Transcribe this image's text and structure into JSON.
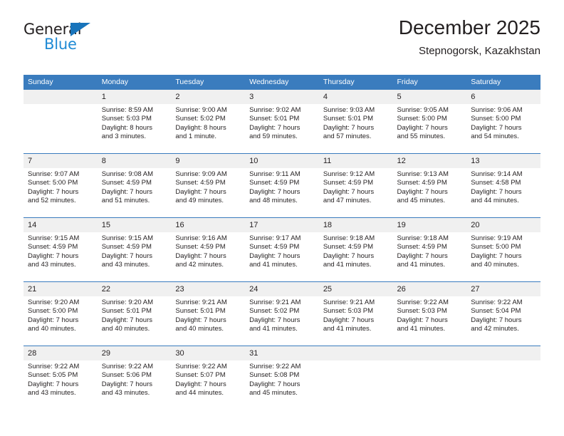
{
  "brand": {
    "name_top": "General",
    "name_bottom": "Blue",
    "accent_color": "#1f8ad4",
    "triangle_color": "#1874bb"
  },
  "header": {
    "title": "December 2025",
    "subtitle": "Stepnogorsk, Kazakhstan",
    "header_bg_color": "#3a7cbe",
    "daynum_bg_color": "#f0f0f0"
  },
  "weekday_headers": [
    "Sunday",
    "Monday",
    "Tuesday",
    "Wednesday",
    "Thursday",
    "Friday",
    "Saturday"
  ],
  "weeks": [
    [
      {
        "day": "",
        "sunrise": "",
        "sunset": "",
        "daylight1": "",
        "daylight2": "",
        "empty": true
      },
      {
        "day": "1",
        "sunrise": "Sunrise: 8:59 AM",
        "sunset": "Sunset: 5:03 PM",
        "daylight1": "Daylight: 8 hours",
        "daylight2": "and 3 minutes."
      },
      {
        "day": "2",
        "sunrise": "Sunrise: 9:00 AM",
        "sunset": "Sunset: 5:02 PM",
        "daylight1": "Daylight: 8 hours",
        "daylight2": "and 1 minute."
      },
      {
        "day": "3",
        "sunrise": "Sunrise: 9:02 AM",
        "sunset": "Sunset: 5:01 PM",
        "daylight1": "Daylight: 7 hours",
        "daylight2": "and 59 minutes."
      },
      {
        "day": "4",
        "sunrise": "Sunrise: 9:03 AM",
        "sunset": "Sunset: 5:01 PM",
        "daylight1": "Daylight: 7 hours",
        "daylight2": "and 57 minutes."
      },
      {
        "day": "5",
        "sunrise": "Sunrise: 9:05 AM",
        "sunset": "Sunset: 5:00 PM",
        "daylight1": "Daylight: 7 hours",
        "daylight2": "and 55 minutes."
      },
      {
        "day": "6",
        "sunrise": "Sunrise: 9:06 AM",
        "sunset": "Sunset: 5:00 PM",
        "daylight1": "Daylight: 7 hours",
        "daylight2": "and 54 minutes."
      }
    ],
    [
      {
        "day": "7",
        "sunrise": "Sunrise: 9:07 AM",
        "sunset": "Sunset: 5:00 PM",
        "daylight1": "Daylight: 7 hours",
        "daylight2": "and 52 minutes."
      },
      {
        "day": "8",
        "sunrise": "Sunrise: 9:08 AM",
        "sunset": "Sunset: 4:59 PM",
        "daylight1": "Daylight: 7 hours",
        "daylight2": "and 51 minutes."
      },
      {
        "day": "9",
        "sunrise": "Sunrise: 9:09 AM",
        "sunset": "Sunset: 4:59 PM",
        "daylight1": "Daylight: 7 hours",
        "daylight2": "and 49 minutes."
      },
      {
        "day": "10",
        "sunrise": "Sunrise: 9:11 AM",
        "sunset": "Sunset: 4:59 PM",
        "daylight1": "Daylight: 7 hours",
        "daylight2": "and 48 minutes."
      },
      {
        "day": "11",
        "sunrise": "Sunrise: 9:12 AM",
        "sunset": "Sunset: 4:59 PM",
        "daylight1": "Daylight: 7 hours",
        "daylight2": "and 47 minutes."
      },
      {
        "day": "12",
        "sunrise": "Sunrise: 9:13 AM",
        "sunset": "Sunset: 4:59 PM",
        "daylight1": "Daylight: 7 hours",
        "daylight2": "and 45 minutes."
      },
      {
        "day": "13",
        "sunrise": "Sunrise: 9:14 AM",
        "sunset": "Sunset: 4:58 PM",
        "daylight1": "Daylight: 7 hours",
        "daylight2": "and 44 minutes."
      }
    ],
    [
      {
        "day": "14",
        "sunrise": "Sunrise: 9:15 AM",
        "sunset": "Sunset: 4:59 PM",
        "daylight1": "Daylight: 7 hours",
        "daylight2": "and 43 minutes."
      },
      {
        "day": "15",
        "sunrise": "Sunrise: 9:15 AM",
        "sunset": "Sunset: 4:59 PM",
        "daylight1": "Daylight: 7 hours",
        "daylight2": "and 43 minutes."
      },
      {
        "day": "16",
        "sunrise": "Sunrise: 9:16 AM",
        "sunset": "Sunset: 4:59 PM",
        "daylight1": "Daylight: 7 hours",
        "daylight2": "and 42 minutes."
      },
      {
        "day": "17",
        "sunrise": "Sunrise: 9:17 AM",
        "sunset": "Sunset: 4:59 PM",
        "daylight1": "Daylight: 7 hours",
        "daylight2": "and 41 minutes."
      },
      {
        "day": "18",
        "sunrise": "Sunrise: 9:18 AM",
        "sunset": "Sunset: 4:59 PM",
        "daylight1": "Daylight: 7 hours",
        "daylight2": "and 41 minutes."
      },
      {
        "day": "19",
        "sunrise": "Sunrise: 9:18 AM",
        "sunset": "Sunset: 4:59 PM",
        "daylight1": "Daylight: 7 hours",
        "daylight2": "and 41 minutes."
      },
      {
        "day": "20",
        "sunrise": "Sunrise: 9:19 AM",
        "sunset": "Sunset: 5:00 PM",
        "daylight1": "Daylight: 7 hours",
        "daylight2": "and 40 minutes."
      }
    ],
    [
      {
        "day": "21",
        "sunrise": "Sunrise: 9:20 AM",
        "sunset": "Sunset: 5:00 PM",
        "daylight1": "Daylight: 7 hours",
        "daylight2": "and 40 minutes."
      },
      {
        "day": "22",
        "sunrise": "Sunrise: 9:20 AM",
        "sunset": "Sunset: 5:01 PM",
        "daylight1": "Daylight: 7 hours",
        "daylight2": "and 40 minutes."
      },
      {
        "day": "23",
        "sunrise": "Sunrise: 9:21 AM",
        "sunset": "Sunset: 5:01 PM",
        "daylight1": "Daylight: 7 hours",
        "daylight2": "and 40 minutes."
      },
      {
        "day": "24",
        "sunrise": "Sunrise: 9:21 AM",
        "sunset": "Sunset: 5:02 PM",
        "daylight1": "Daylight: 7 hours",
        "daylight2": "and 41 minutes."
      },
      {
        "day": "25",
        "sunrise": "Sunrise: 9:21 AM",
        "sunset": "Sunset: 5:03 PM",
        "daylight1": "Daylight: 7 hours",
        "daylight2": "and 41 minutes."
      },
      {
        "day": "26",
        "sunrise": "Sunrise: 9:22 AM",
        "sunset": "Sunset: 5:03 PM",
        "daylight1": "Daylight: 7 hours",
        "daylight2": "and 41 minutes."
      },
      {
        "day": "27",
        "sunrise": "Sunrise: 9:22 AM",
        "sunset": "Sunset: 5:04 PM",
        "daylight1": "Daylight: 7 hours",
        "daylight2": "and 42 minutes."
      }
    ],
    [
      {
        "day": "28",
        "sunrise": "Sunrise: 9:22 AM",
        "sunset": "Sunset: 5:05 PM",
        "daylight1": "Daylight: 7 hours",
        "daylight2": "and 43 minutes."
      },
      {
        "day": "29",
        "sunrise": "Sunrise: 9:22 AM",
        "sunset": "Sunset: 5:06 PM",
        "daylight1": "Daylight: 7 hours",
        "daylight2": "and 43 minutes."
      },
      {
        "day": "30",
        "sunrise": "Sunrise: 9:22 AM",
        "sunset": "Sunset: 5:07 PM",
        "daylight1": "Daylight: 7 hours",
        "daylight2": "and 44 minutes."
      },
      {
        "day": "31",
        "sunrise": "Sunrise: 9:22 AM",
        "sunset": "Sunset: 5:08 PM",
        "daylight1": "Daylight: 7 hours",
        "daylight2": "and 45 minutes."
      },
      {
        "day": "",
        "sunrise": "",
        "sunset": "",
        "daylight1": "",
        "daylight2": "",
        "empty": true
      },
      {
        "day": "",
        "sunrise": "",
        "sunset": "",
        "daylight1": "",
        "daylight2": "",
        "empty": true
      },
      {
        "day": "",
        "sunrise": "",
        "sunset": "",
        "daylight1": "",
        "daylight2": "",
        "empty": true
      }
    ]
  ]
}
